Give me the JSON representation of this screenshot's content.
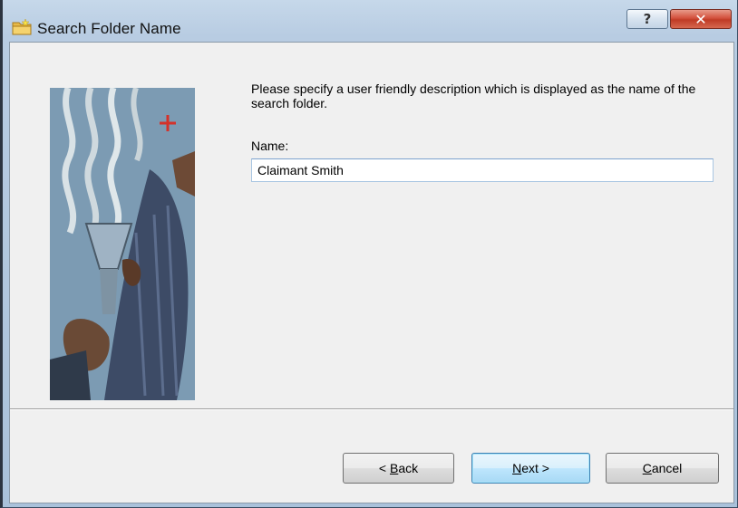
{
  "window": {
    "title": "Search Folder Name",
    "icon": "folder-icon",
    "help_label": "?",
    "close_label": "✕"
  },
  "main": {
    "prompt": "Please specify a user friendly description which is displayed as the name of the search folder.",
    "name_label": "Name:",
    "name_value": "Claimant Smith"
  },
  "buttons": {
    "back": {
      "prefix": "< ",
      "accel": "B",
      "rest": "ack"
    },
    "next": {
      "prefix": "",
      "accel": "N",
      "rest": "ext >"
    },
    "cancel": {
      "prefix": "",
      "accel": "C",
      "rest": "ancel"
    }
  },
  "side_image": "wizard-illustration-man-with-megaphone"
}
